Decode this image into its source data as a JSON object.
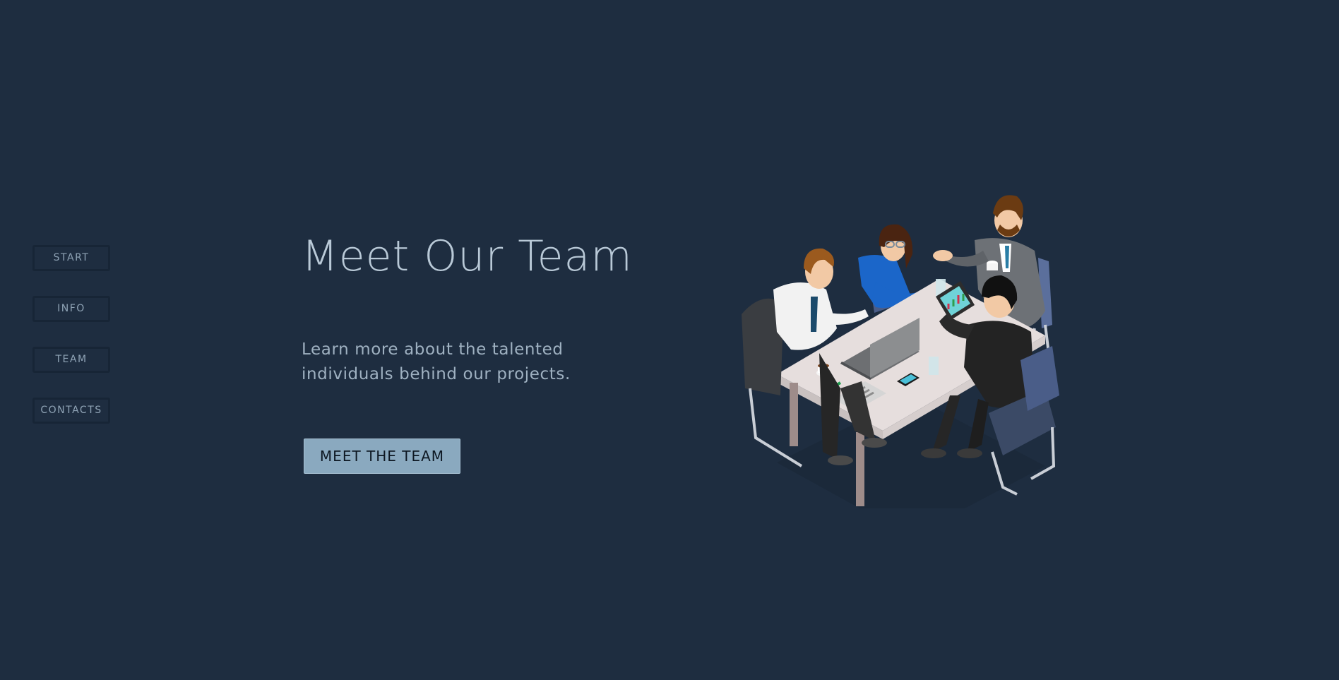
{
  "nav": {
    "items": [
      {
        "label": "START"
      },
      {
        "label": "INFO"
      },
      {
        "label": "TEAM"
      },
      {
        "label": "CONTACTS"
      }
    ]
  },
  "hero": {
    "title": "Meet Our Team",
    "description": "Learn more about the talented individuals behind our projects.",
    "cta_label": "MEET THE TEAM"
  },
  "illustration": {
    "icon": "team-meeting-illustration"
  },
  "colors": {
    "background": "#1e2d40",
    "nav_border": "#172536",
    "nav_text": "#8fa3b5",
    "title": "#b9c9d7",
    "body_text": "#9fb1c1",
    "cta_background": "#8aa9bf"
  }
}
